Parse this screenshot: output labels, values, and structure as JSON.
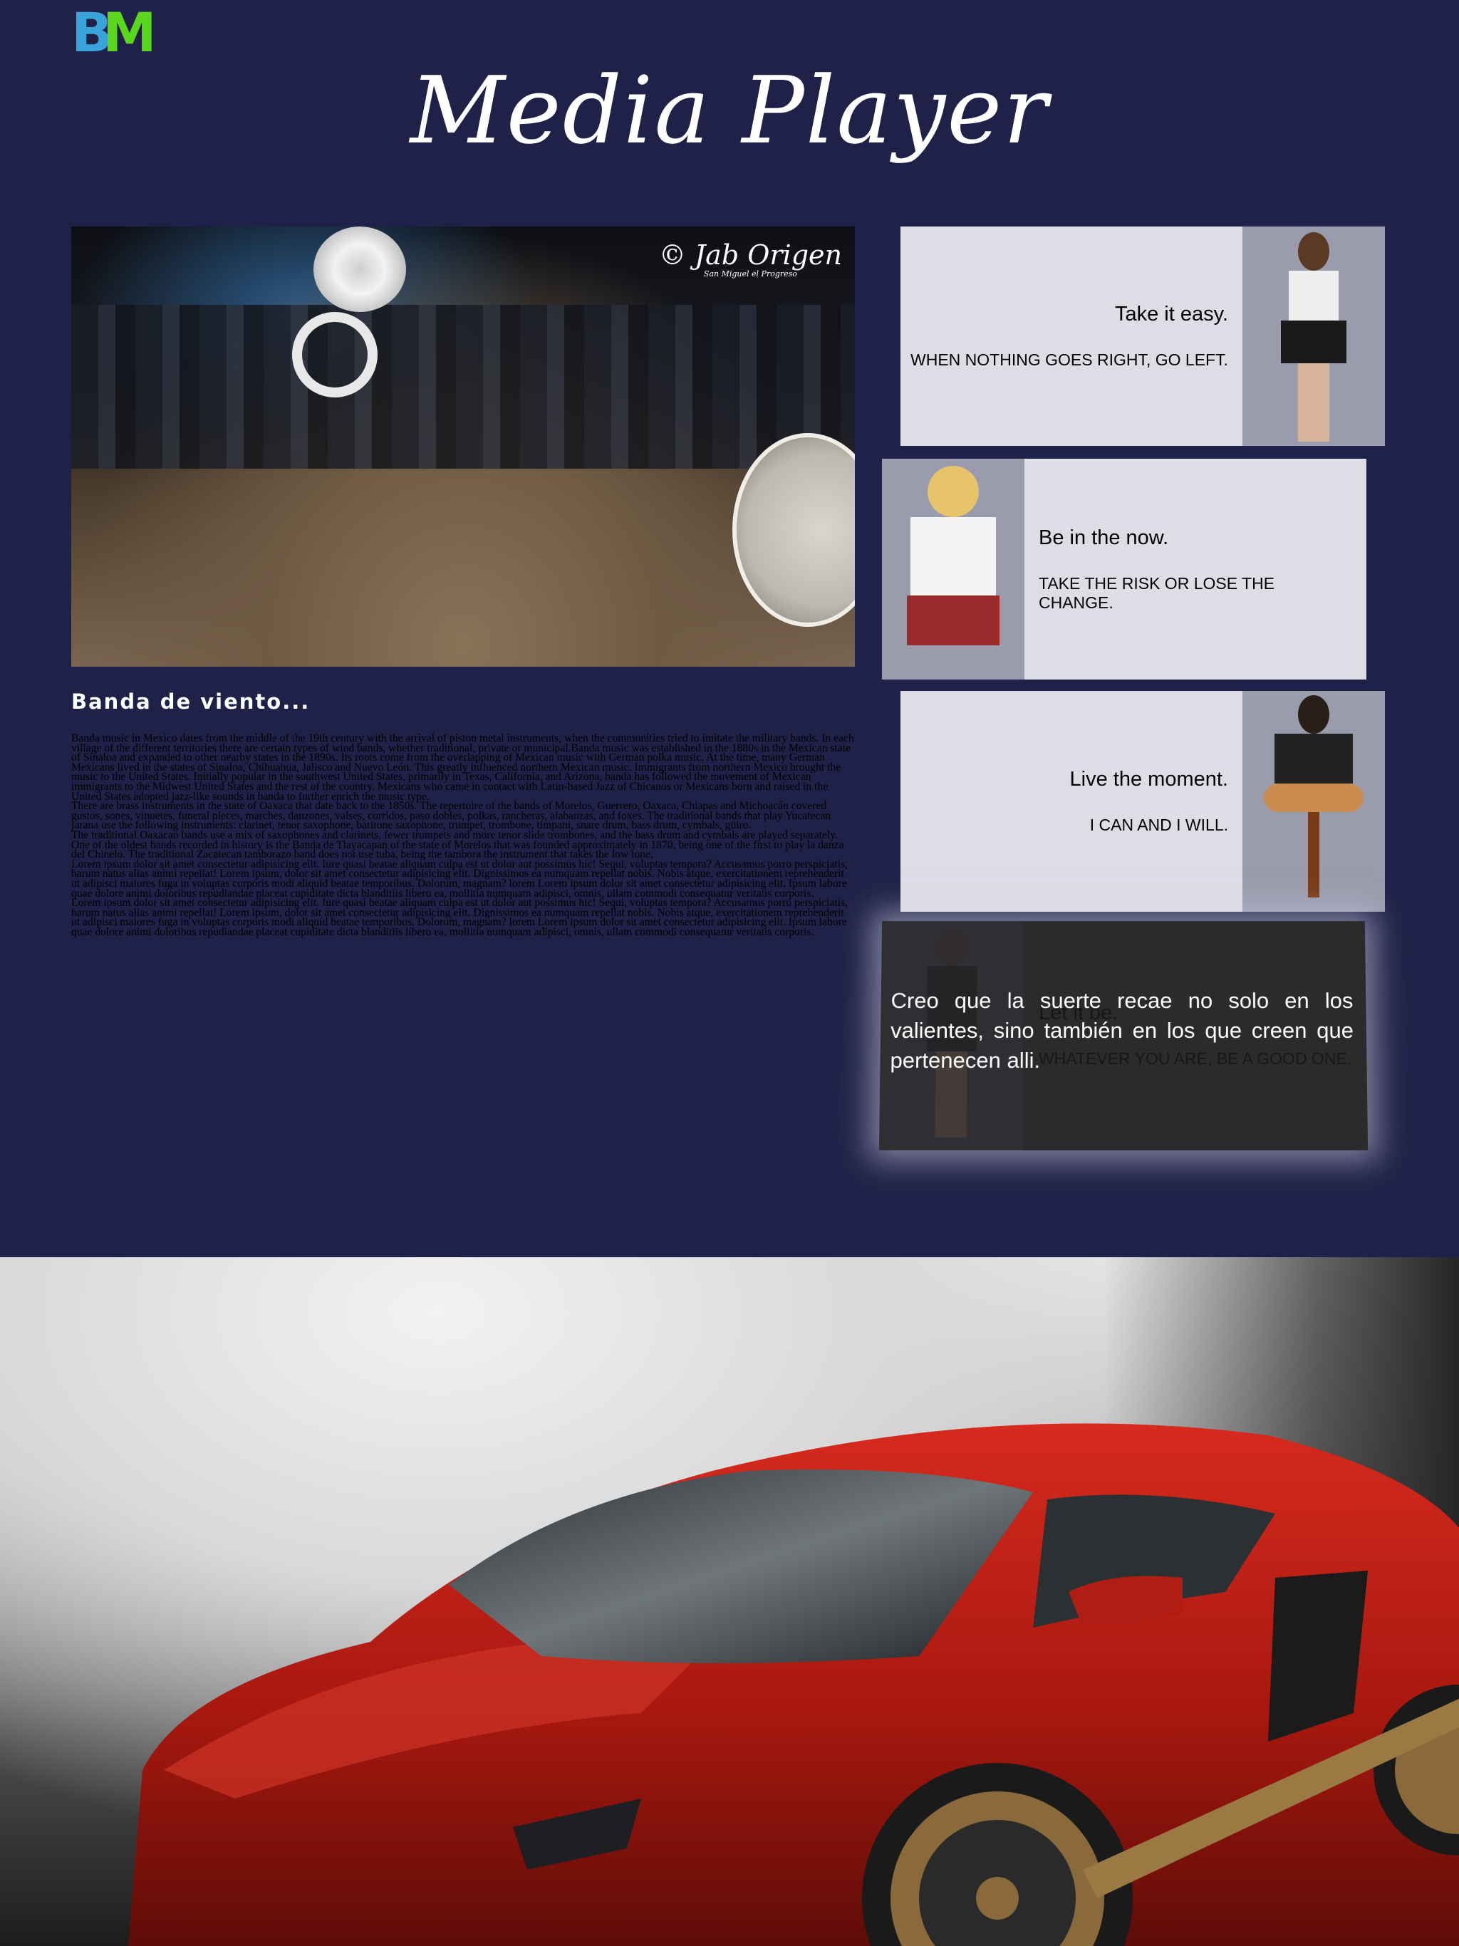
{
  "header": {
    "logo_left": "B",
    "logo_right": "M",
    "title": "Media Player"
  },
  "video": {
    "watermark": "© Jab Origen",
    "watermark_sub": "San Miguel el Progreso"
  },
  "article": {
    "title": "Banda de viento...",
    "paragraphs": [
      "Banda music in Mexico dates from the middle of the 19th century with the arrival of piston metal instruments, when the communities tried to imitate the military bands. In each village of the different territories there are certain types of wind bands, whether traditional, private or municipal.Banda music was established in the 1880s in the Mexican state of Sinaloa and expanded to other nearby states in the 1890s. Its roots come from the overlapping of Mexican music with German polka music. At the time, many German Mexicans lived in the states of Sinaloa, Chihuahua, Jalisco and Nuevo León. This greatly influenced northern Mexican music. Immigrants from northern Mexico brought the music to the United States. Initially popular in the southwest United States, primarily in Texas, California, and Arizona, banda has followed the movement of Mexican immigrants to the Midwest United States and the rest of the country. Mexicans who came in contact with Latin-based Jazz of Chicanos or Mexicans born and raised in the United States adopted jazz-like sounds in banda to further enrich the music type.",
      "There are brass instruments in the state of Oaxaca that date back to the 1850s. The repertoire of the bands of Morelos, Guerrero, Oaxaca, Chiapas and Michoacán covered gustos, sones, vinuetes, funeral pieces, marches, danzones, valses, corridos, paso dobles, polkas, rancheras, alabanzas, and foxes. The traditional bands that play Yucatecan jarana use the following instruments: clarinet, tenor saxophone, baritone saxophone, trumpet, trombone, timpani, snare drum, bass drum, cymbals, güiro.",
      "The traditional Oaxacan bands use a mix of saxophones and clarinets, fewer trumpets and more tenor slide trombones, and the bass drum and cymbals are played separately. One of the oldest bands recorded in history is the Banda de Tlayacapan of the state of Morelos that was founded approximately in 1870, being one of the first to play la danza del Chinelo. The traditional Zacatecan tamborazo band does not use tuba, being the tambora the instrument that takes the low tone.",
      "Lorem ipsum dolor sit amet consectetur adipisicing elit. Iure quasi beatae aliquam culpa est ut dolor aut possimus hic! Sequi, voluptas tempora? Accusamus porro perspiciatis, harum natus alias animi repellat! Lorem ipsum, dolor sit amet consectetur adipisicing elit. Dignissimos ea numquam repellat nobis. Nobis atque, exercitationem reprehenderit ut adipisci maiores fuga in voluptas corporis modi aliquid beatae temporibus. Dolorum, magnam? lorem Lorem ipsum dolor sit amet consectetur adipisicing elit. Ipsum labore quae dolore animi doloribus repudiandae placeat cupiditate dicta blanditiis libero ea, mollitia numquam adipisci, omnis, ullam commodi consequatur veritatis corporis.",
      "Lorem ipsum dolor sit amet consectetur adipisicing elit. Iure quasi beatae aliquam culpa est ut dolor aut possimus hic! Sequi, voluptas tempora? Accusamus porro perspiciatis, harum natus alias animi repellat! Lorem ipsum, dolor sit amet consectetur adipisicing elit. Dignissimos ea numquam repellat nobis. Nobis atque, exercitationem reprehenderit ut adipisci maiores fuga in voluptas corporis modi aliquid beatae temporibus. Dolorum, magnam? lorem Lorem ipsum dolor sit amet consectetur adipisicing elit. Ipsum labore quae dolore animi doloribus repudiandae placeat cupiditate dicta blanditiis libero ea, mollitia numquam adipisci, omnis, ullam commodi consequatur veritatis corporis."
    ]
  },
  "cards": [
    {
      "heading": "Take it easy.",
      "sub": "WHEN NOTHING GOES RIGHT, GO LEFT."
    },
    {
      "heading": "Be in the now.",
      "sub": "TAKE THE RISK OR LOSE THE CHANGE."
    },
    {
      "heading": "Live the moment.",
      "sub": "I CAN AND I WILL."
    },
    {
      "heading": "Let it be.",
      "sub": "WHATEVER YOU ARE, BE A GOOD ONE.",
      "quote": "Creo que la suerte recae no solo en los valientes, sino también en los que creen que pertenecen alli."
    }
  ],
  "colors": {
    "page_bg": "#1f2148",
    "card_bg": "#dedde5",
    "photo_bg": "#9a9cae",
    "logo_blue": "#3aa3d9",
    "logo_green": "#5ad61c",
    "car_red": "#b51c14"
  }
}
